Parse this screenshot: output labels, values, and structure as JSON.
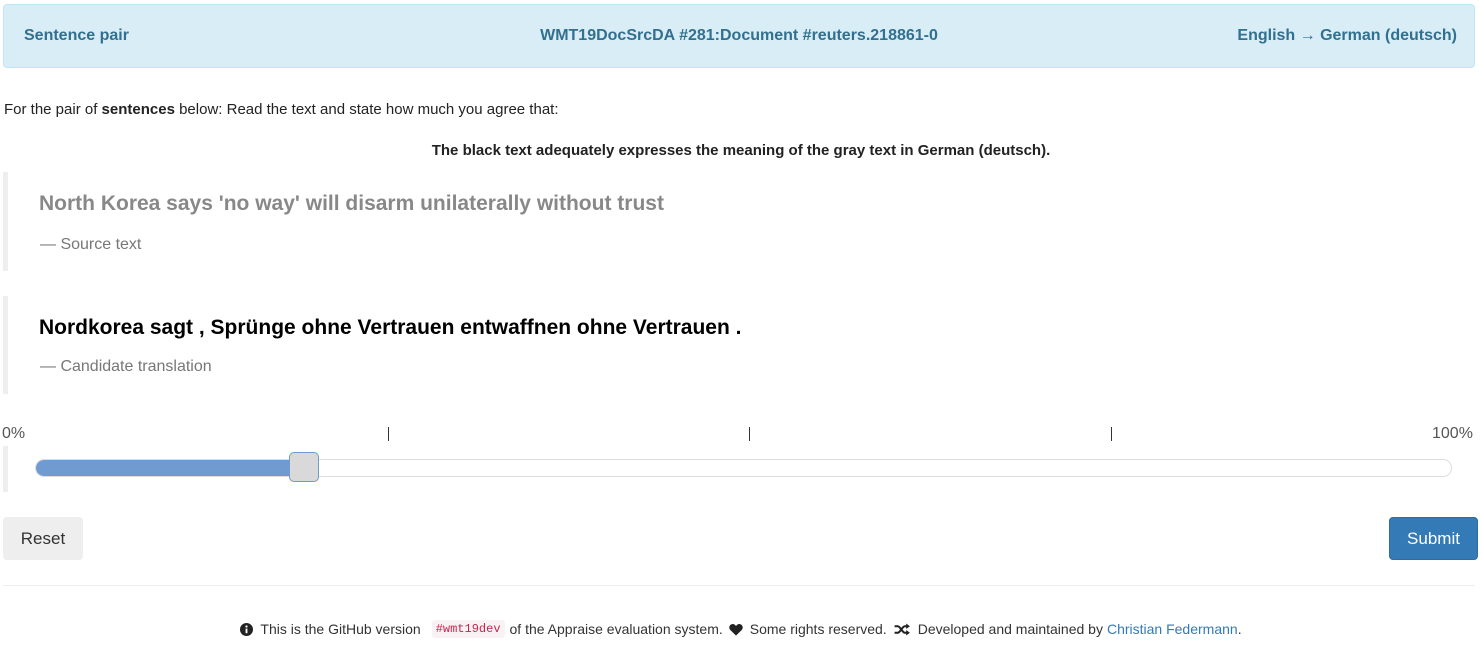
{
  "header": {
    "left": "Sentence pair",
    "center": "WMT19DocSrcDA #281:Document #reuters.218861-0",
    "right": "English → German (deutsch)"
  },
  "instructions": {
    "prefix": "For the pair of ",
    "bold": "sentences",
    "suffix": " below: Read the text and state how much you agree that:"
  },
  "criteria": "The black text adequately expresses the meaning of the gray text in German (deutsch).",
  "source": {
    "text": "North Korea says 'no way' will disarm unilaterally without trust",
    "cite": "— Source text"
  },
  "candidate": {
    "text": "Nordkorea sagt , Sprünge ohne Vertrauen entwaffnen ohne Vertrauen .",
    "cite": "— Candidate translation"
  },
  "scale": {
    "min_label": "0%",
    "max_label": "100%",
    "tick_mark": "|",
    "value_percent": 19
  },
  "buttons": {
    "reset": "Reset",
    "submit": "Submit"
  },
  "footer": {
    "part1": "This is the GitHub version",
    "tag": "#wmt19dev",
    "part2": "of the Appraise evaluation system.",
    "part3": "Some rights reserved.",
    "part4": "Developed and maintained by",
    "author": "Christian Federmann",
    "end": "."
  },
  "colors": {
    "header_bg": "#d9edf7",
    "header_text": "#31708f",
    "slider_fill": "#6f9bd1",
    "submit_bg": "#337ab7",
    "link": "#337ab7"
  },
  "icons": [
    "info-icon",
    "heart-icon",
    "shuffle-icon"
  ]
}
